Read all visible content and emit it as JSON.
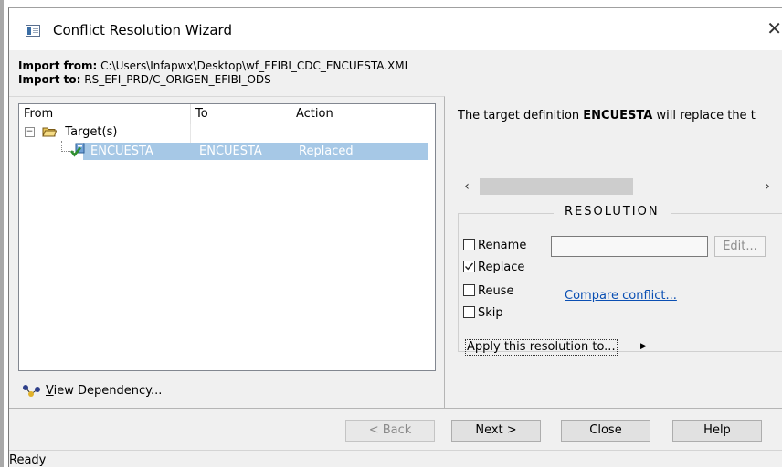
{
  "window": {
    "title": "Conflict Resolution Wizard",
    "close_glyph": "✕"
  },
  "import": {
    "from_label": "Import from:",
    "from_value": "C:\\Users\\Infapwx\\Desktop\\wf_EFIBI_CDC_ENCUESTA.XML",
    "to_label": "Import to:",
    "to_value": "RS_EFI_PRD/C_ORIGEN_EFIBI_ODS"
  },
  "tree": {
    "columns": [
      "From",
      "To",
      "Action"
    ],
    "group": {
      "label": "Target(s)",
      "expander": "−"
    },
    "row": {
      "from": "ENCUESTA",
      "to": "ENCUESTA",
      "action": "Replaced"
    }
  },
  "view_dependency": {
    "label_first": "V",
    "label_rest": "iew Dependency..."
  },
  "description": {
    "prefix": "The target definition ",
    "name": "ENCUESTA",
    "suffix": " will replace the t"
  },
  "resolution": {
    "legend": "RESOLUTION",
    "options": [
      {
        "label": "Rename",
        "checked": false
      },
      {
        "label": "Replace",
        "checked": true
      },
      {
        "label": "Reuse",
        "checked": false
      },
      {
        "label": "Skip",
        "checked": false
      }
    ],
    "edit_label": "Edit...",
    "compare_label": "Compare conflict...",
    "apply_label": "Apply this resolution to...",
    "apply_arrow": "▶"
  },
  "buttons": {
    "back": "< Back",
    "next": "Next >",
    "close": "Close",
    "help": "Help"
  },
  "status": "Ready",
  "colors": {
    "selection": "#a6c8e6",
    "link": "#0a4fb3",
    "background": "#f0f0f0"
  }
}
